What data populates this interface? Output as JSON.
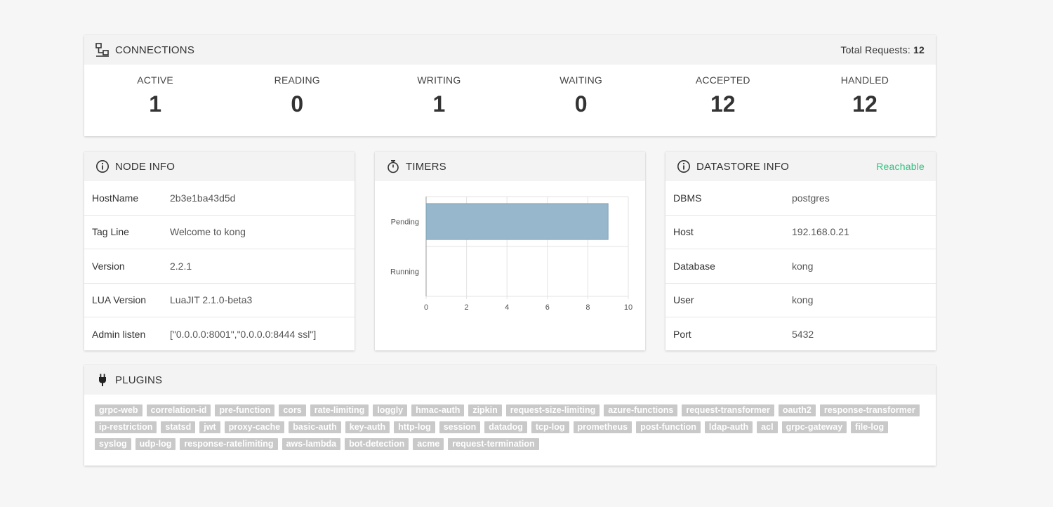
{
  "connections": {
    "title": "CONNECTIONS",
    "total_label": "Total Requests:",
    "total_value": "12",
    "stats": [
      {
        "label": "ACTIVE",
        "value": "1"
      },
      {
        "label": "READING",
        "value": "0"
      },
      {
        "label": "WRITING",
        "value": "1"
      },
      {
        "label": "WAITING",
        "value": "0"
      },
      {
        "label": "ACCEPTED",
        "value": "12"
      },
      {
        "label": "HANDLED",
        "value": "12"
      }
    ]
  },
  "node_info": {
    "title": "NODE INFO",
    "rows": [
      {
        "key": "HostName",
        "value": "2b3e1ba43d5d"
      },
      {
        "key": "Tag Line",
        "value": "Welcome to kong"
      },
      {
        "key": "Version",
        "value": "2.2.1"
      },
      {
        "key": "LUA Version",
        "value": "LuaJIT 2.1.0-beta3"
      },
      {
        "key": "Admin listen",
        "value": "[\"0.0.0.0:8001\",\"0.0.0.0:8444 ssl\"]"
      }
    ]
  },
  "timers": {
    "title": "TIMERS"
  },
  "chart_data": {
    "type": "bar",
    "orientation": "horizontal",
    "categories": [
      "Pending",
      "Running"
    ],
    "values": [
      9,
      0
    ],
    "xlim": [
      0,
      10
    ],
    "xticks": [
      "0",
      "2",
      "4",
      "6",
      "8",
      "10"
    ],
    "grid": true,
    "bar_color": "#97b8cc"
  },
  "datastore": {
    "title": "DATASTORE INFO",
    "status": "Reachable",
    "status_color": "#2ec27e",
    "rows": [
      {
        "key": "DBMS",
        "value": "postgres"
      },
      {
        "key": "Host",
        "value": "192.168.0.21"
      },
      {
        "key": "Database",
        "value": "kong"
      },
      {
        "key": "User",
        "value": "kong"
      },
      {
        "key": "Port",
        "value": "5432"
      }
    ]
  },
  "plugins": {
    "title": "PLUGINS",
    "items": [
      "grpc-web",
      "correlation-id",
      "pre-function",
      "cors",
      "rate-limiting",
      "loggly",
      "hmac-auth",
      "zipkin",
      "request-size-limiting",
      "azure-functions",
      "request-transformer",
      "oauth2",
      "response-transformer",
      "ip-restriction",
      "statsd",
      "jwt",
      "proxy-cache",
      "basic-auth",
      "key-auth",
      "http-log",
      "session",
      "datadog",
      "tcp-log",
      "prometheus",
      "post-function",
      "ldap-auth",
      "acl",
      "grpc-gateway",
      "file-log",
      "syslog",
      "udp-log",
      "response-ratelimiting",
      "aws-lambda",
      "bot-detection",
      "acme",
      "request-termination"
    ]
  },
  "icons": {
    "connections": "network-icon",
    "node_info": "info-icon",
    "timers": "stopwatch-icon",
    "datastore": "info-icon",
    "plugins": "plug-icon"
  }
}
